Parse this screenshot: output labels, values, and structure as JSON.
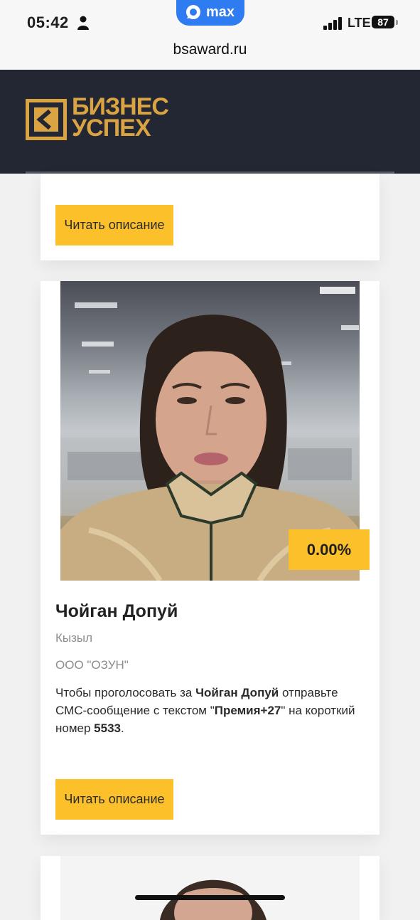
{
  "status_bar": {
    "time": "05:42",
    "app_pill": "max",
    "network": "LTE",
    "battery": "87"
  },
  "browser": {
    "url": "bsaward.ru"
  },
  "site": {
    "logo_line1": "БИЗНЕС",
    "logo_line2": "УСПЕХ",
    "brand_color": "#d9a441",
    "header_bg": "#232733"
  },
  "cards": [
    {
      "read_button": "Читать описание"
    },
    {
      "percent": "0.00%",
      "name": "Чойган Допуй",
      "city": "Кызыл",
      "organization": "ООО \"ОЗУН\"",
      "vote": {
        "part1": "Чтобы проголосовать за ",
        "name": "Чойган Допуй",
        "part2": " отправьте СМС-сообщение с текстом \"",
        "code": "Премия+27",
        "part3": "\" на короткий номер ",
        "number": "5533",
        "part4": "."
      },
      "read_button": "Читать описание"
    }
  ],
  "accent_color": "#fcc02a",
  "icons": [
    "person-icon",
    "chat-bubble-icon",
    "signal-bars-icon",
    "battery-icon",
    "brand-logo-icon"
  ]
}
